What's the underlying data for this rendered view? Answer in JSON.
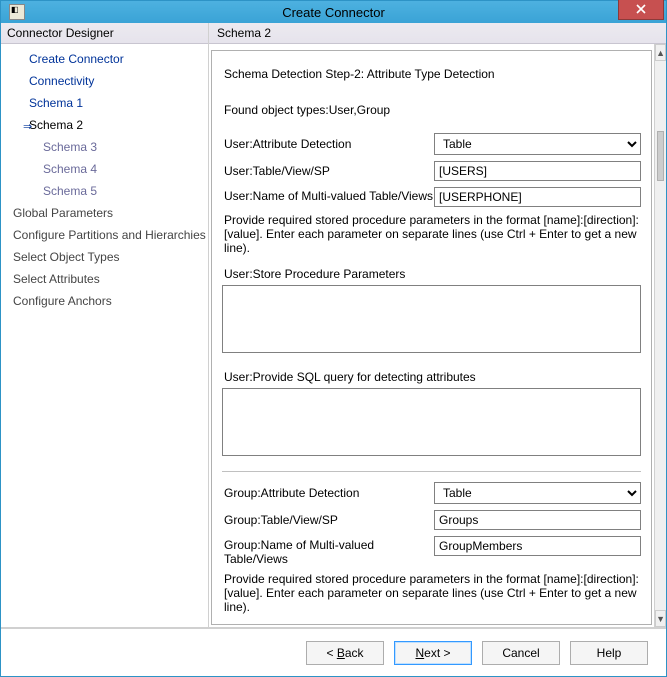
{
  "window": {
    "title": "Create Connector"
  },
  "sidebar": {
    "header": "Connector Designer",
    "items": [
      {
        "label": "Create Connector",
        "kind": "link"
      },
      {
        "label": "Connectivity",
        "kind": "link"
      },
      {
        "label": "Schema 1",
        "kind": "link"
      },
      {
        "label": "Schema 2",
        "kind": "selected"
      },
      {
        "label": "Schema 3",
        "kind": "sub"
      },
      {
        "label": "Schema 4",
        "kind": "sub"
      },
      {
        "label": "Schema 5",
        "kind": "sub"
      },
      {
        "label": "Global Parameters",
        "kind": "plain"
      },
      {
        "label": "Configure Partitions and Hierarchies",
        "kind": "plain"
      },
      {
        "label": "Select Object Types",
        "kind": "plain"
      },
      {
        "label": "Select Attributes",
        "kind": "plain"
      },
      {
        "label": "Configure Anchors",
        "kind": "plain"
      }
    ]
  },
  "content": {
    "header": "Schema 2",
    "step_title": "Schema Detection Step-2: Attribute Type Detection",
    "found_types": "Found object types:User,Group",
    "user": {
      "attr_detection_label": "User:Attribute Detection",
      "attr_detection_value": "Table",
      "table_label": "User:Table/View/SP",
      "table_value": "[USERS]",
      "multi_label": "User:Name of Multi-valued Table/Views",
      "multi_value": "[USERPHONE]",
      "help": "Provide required stored procedure parameters in the format [name]:[direction]:[value]. Enter each parameter on separate lines (use Ctrl + Enter to get a new line).",
      "sp_params_label": "User:Store Procedure Parameters",
      "sp_params_value": "",
      "sql_label": "User:Provide SQL query for detecting attributes",
      "sql_value": ""
    },
    "group": {
      "attr_detection_label": "Group:Attribute Detection",
      "attr_detection_value": "Table",
      "table_label": "Group:Table/View/SP",
      "table_value": "Groups",
      "multi_label": "Group:Name of Multi-valued Table/Views",
      "multi_value": "GroupMembers",
      "help": "Provide required stored procedure parameters in the format [name]:[direction]:[value]. Enter each parameter on separate lines (use Ctrl + Enter to get a new line)."
    }
  },
  "buttons": {
    "back_prefix": "< ",
    "back_u": "B",
    "back_rest": "ack",
    "next_u": "N",
    "next_rest": "ext  >",
    "cancel": "Cancel",
    "help": "Help"
  },
  "dropdown_options": {
    "table": "Table"
  }
}
